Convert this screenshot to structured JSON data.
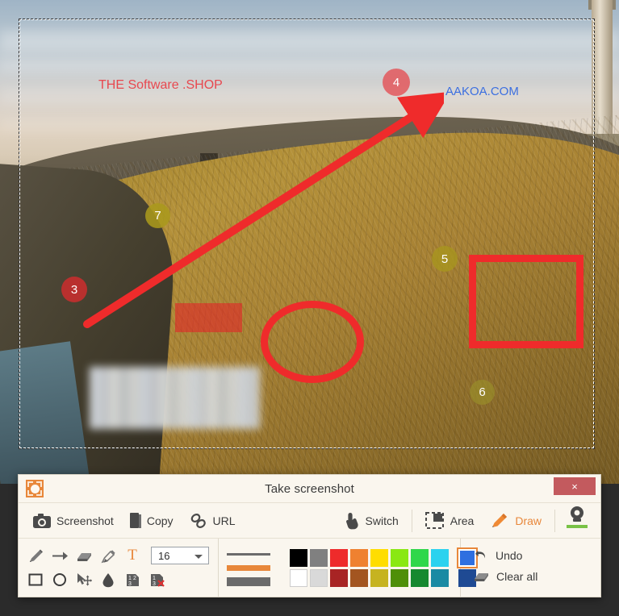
{
  "window": {
    "title": "Take screenshot",
    "app_icon": "camera-target-icon",
    "close_label": "×"
  },
  "actions": {
    "screenshot": {
      "label": "Screenshot",
      "icon": "camera-icon"
    },
    "copy": {
      "label": "Copy",
      "icon": "clipboard-icon"
    },
    "url": {
      "label": "URL",
      "icon": "link-icon"
    },
    "switch": {
      "label": "Switch",
      "icon": "hand-pointer-icon"
    },
    "area": {
      "label": "Area",
      "icon": "selection-area-icon"
    },
    "draw": {
      "label": "Draw",
      "icon": "pencil-icon",
      "active": true
    },
    "webcam": {
      "label": "",
      "icon": "webcam-icon"
    }
  },
  "tools": {
    "row1": [
      {
        "name": "pencil-tool",
        "icon": "pencil-icon"
      },
      {
        "name": "arrow-tool",
        "icon": "arrow-right-icon"
      },
      {
        "name": "eraser-tool",
        "icon": "eraser-icon"
      },
      {
        "name": "highlighter-tool",
        "icon": "highlighter-icon"
      },
      {
        "name": "text-tool",
        "icon": "text-T-icon",
        "label": "T",
        "active": true
      }
    ],
    "row2": [
      {
        "name": "rectangle-tool",
        "icon": "rectangle-icon"
      },
      {
        "name": "ellipse-tool",
        "icon": "ellipse-icon"
      },
      {
        "name": "move-tool",
        "icon": "cursor-move-icon"
      },
      {
        "name": "blur-tool",
        "icon": "droplet-icon"
      },
      {
        "name": "number-badge-tool",
        "icon": "number-123-icon"
      },
      {
        "name": "number-badge-clear-tool",
        "icon": "number-123-clear-icon"
      }
    ],
    "font_size": {
      "value": "16",
      "label": "16"
    }
  },
  "style": {
    "thickness_options": [
      {
        "name": "thin",
        "height": 3,
        "selected": false
      },
      {
        "name": "medium",
        "height": 7,
        "selected": true
      },
      {
        "name": "thick",
        "height": 10,
        "selected": false
      }
    ],
    "current_color": "#2f6fe0",
    "palette_row1": [
      "#000000",
      "#808080",
      "#ee2b2b",
      "#ef8130",
      "#ffdd00",
      "#8ae813",
      "#2fd74a",
      "#2bd2ef",
      "#2f6fe0"
    ],
    "palette_row2": [
      "#ffffff",
      "#d9d9d9",
      "#a82424",
      "#a35520",
      "#c6b320",
      "#4e8f08",
      "#16892f",
      "#1a8aa3",
      "#1f4a93"
    ],
    "selected_swatch_index": 8
  },
  "edit": {
    "undo": {
      "label": "Undo",
      "icon": "undo-arrow-icon"
    },
    "clear_all": {
      "label": "Clear all",
      "icon": "eraser-icon"
    }
  },
  "canvas": {
    "annotations": {
      "text_red": {
        "text": "THE Software .SHOP",
        "color": "#e8484f"
      },
      "text_blue": {
        "text": "AAKOA.COM",
        "color": "#3c6fe0"
      },
      "badges": [
        {
          "number": "3",
          "color": "#c82e2e"
        },
        {
          "number": "4",
          "color": "#e45055"
        },
        {
          "number": "5",
          "color": "#a8961e"
        },
        {
          "number": "6",
          "color": "#988c2a"
        },
        {
          "number": "7",
          "color": "#aa981c"
        }
      ],
      "shapes": {
        "arrow": {
          "name": "red-arrow",
          "color": "#ef2b2b"
        },
        "rectangle": {
          "name": "red-rectangle",
          "color": "#ef2b2b"
        },
        "ellipse": {
          "name": "red-ellipse",
          "color": "#ef2b2b"
        },
        "highlight": {
          "name": "red-highlight-swipe",
          "color": "#e02828"
        },
        "blur": {
          "name": "blurred-region"
        }
      }
    }
  }
}
